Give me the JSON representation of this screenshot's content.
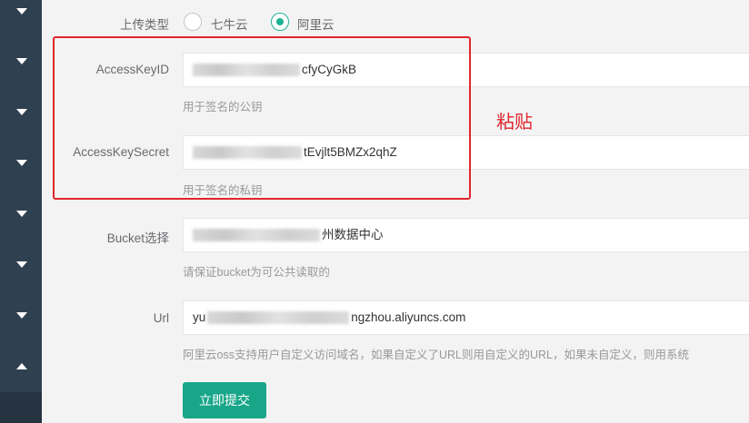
{
  "upload_type": {
    "label": "上传类型",
    "options": [
      {
        "label": "七牛云",
        "checked": false
      },
      {
        "label": "阿里云",
        "checked": true
      }
    ]
  },
  "access_key_id": {
    "label": "AccessKeyID",
    "visible_value": "cfyCyGkB",
    "help": "用于签名的公钥"
  },
  "access_key_secret": {
    "label": "AccessKeySecret",
    "visible_value": "tEvjlt5BMZx2qhZ",
    "help": "用于签名的私钥"
  },
  "bucket": {
    "label": "Bucket选择",
    "visible_value": "州数据中心",
    "help": "请保证bucket为可公共读取的"
  },
  "url": {
    "label": "Url",
    "visible_prefix": "yu",
    "visible_value": "ngzhou.aliyuncs.com",
    "help": "阿里云oss支持用户自定义访问域名，如果自定义了URL则用自定义的URL，如果未自定义，则用系统"
  },
  "annotation": "粘贴",
  "submit_label": "立即提交",
  "colors": {
    "sidebar": "#2f4050",
    "accent": "#1ab394",
    "annotation_red": "#e1262d"
  },
  "icons": {
    "sidebar_items": [
      "chevron-down-icon",
      "chevron-down-icon",
      "chevron-down-icon",
      "chevron-down-icon",
      "chevron-down-icon",
      "chevron-down-icon",
      "chevron-down-icon",
      "chevron-up-icon"
    ]
  }
}
